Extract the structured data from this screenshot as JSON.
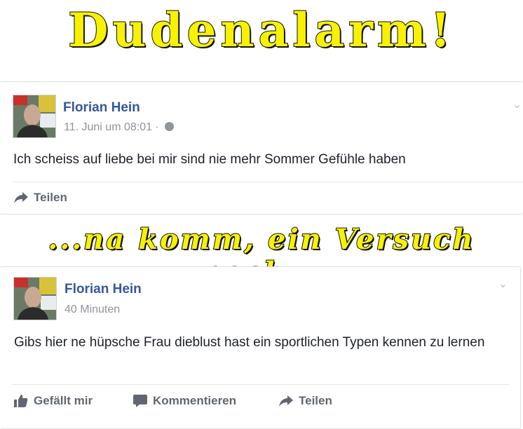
{
  "banner_top": "Dudenalarm!",
  "banner_mid": "...na komm, ein Versuch noch...",
  "colors": {
    "banner_fill": "#f7f200",
    "link_blue": "#365899",
    "meta_gray": "#90949c"
  },
  "post1": {
    "author": "Florian Hein",
    "timestamp": "11. Juni um 08:01",
    "separator": "·",
    "privacy_icon": "globe-icon",
    "text": "Ich scheiss auf liebe bei mir sind nie mehr Sommer Gefühle haben",
    "share_label": "Teilen"
  },
  "post2": {
    "author": "Florian Hein",
    "timestamp": "40 Minuten",
    "text": "Gibs hier ne hüpsche Frau dieblust hast ein sportlichen Typen kennen zu lernen",
    "like_label": "Gefällt mir",
    "comment_label": "Kommentieren",
    "share_label": "Teilen"
  }
}
